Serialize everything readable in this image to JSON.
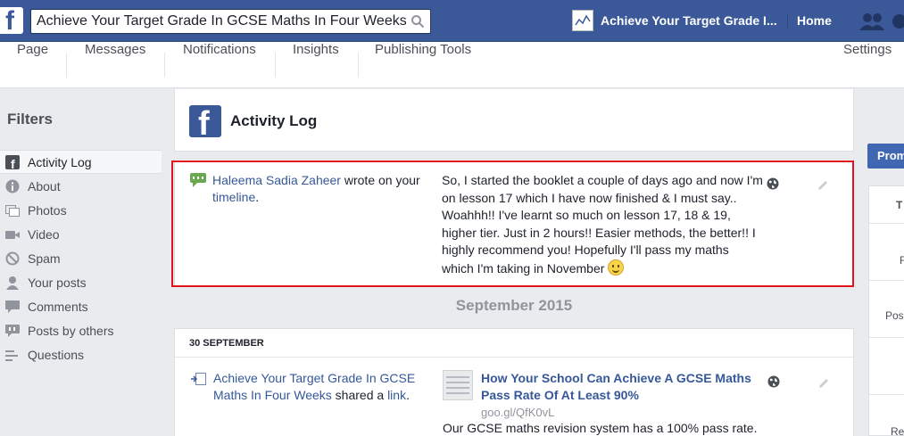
{
  "topbar": {
    "search_value": "Achieve Your Target Grade In GCSE Maths In Four Weeks",
    "page_name": "Achieve Your Target Grade I...",
    "home_label": "Home"
  },
  "pagenav": {
    "tabs": [
      "Page",
      "Messages",
      "Notifications",
      "Insights",
      "Publishing Tools"
    ],
    "settings_label": "Settings"
  },
  "filters": {
    "title": "Filters",
    "items": [
      {
        "label": "Activity Log",
        "icon": "facebook-icon",
        "active": true
      },
      {
        "label": "About",
        "icon": "info-icon"
      },
      {
        "label": "Photos",
        "icon": "photos-icon"
      },
      {
        "label": "Video",
        "icon": "video-icon"
      },
      {
        "label": "Spam",
        "icon": "spam-icon"
      },
      {
        "label": "Your posts",
        "icon": "person-icon"
      },
      {
        "label": "Comments",
        "icon": "comment-icon"
      },
      {
        "label": "Posts by others",
        "icon": "posts-by-others-icon"
      },
      {
        "label": "Questions",
        "icon": "questions-icon"
      }
    ]
  },
  "activity_log": {
    "title": "Activity Log",
    "entry": {
      "actor": "Haleema Sadia Zaheer",
      "action": " wrote on your ",
      "target": "timeline",
      "target_suffix": ".",
      "text": "So, I started the booklet a couple of days ago and now I'm on lesson 17 which I have now finished & I must say.. Woahhh!! I've learnt so much on lesson 17, 18 & 19, higher tier. Just in 2 hours!! Easier methods, the better!! I highly recommend you! Hopefully I'll pass my maths which I'm taking in November"
    },
    "month": "September 2015",
    "day": {
      "date": "30 SEPTEMBER",
      "share": {
        "actor": "Achieve Your Target Grade In GCSE Maths In Four Weeks",
        "action": " shared a ",
        "link_word": "link",
        "suffix": ".",
        "link_title": "How Your School Can Achieve A GCSE Maths Pass Rate Of At Least 90%",
        "link_domain": "goo.gl/QfK0vL",
        "link_desc": "Our GCSE maths revision system has a 100% pass rate."
      }
    }
  },
  "right": {
    "promote_label": "Prom",
    "rows": [
      "T",
      "F",
      "Pos",
      "Re"
    ]
  },
  "colors": {
    "brand": "#3b5998",
    "link": "#365899",
    "highlight": "#e0141c"
  }
}
